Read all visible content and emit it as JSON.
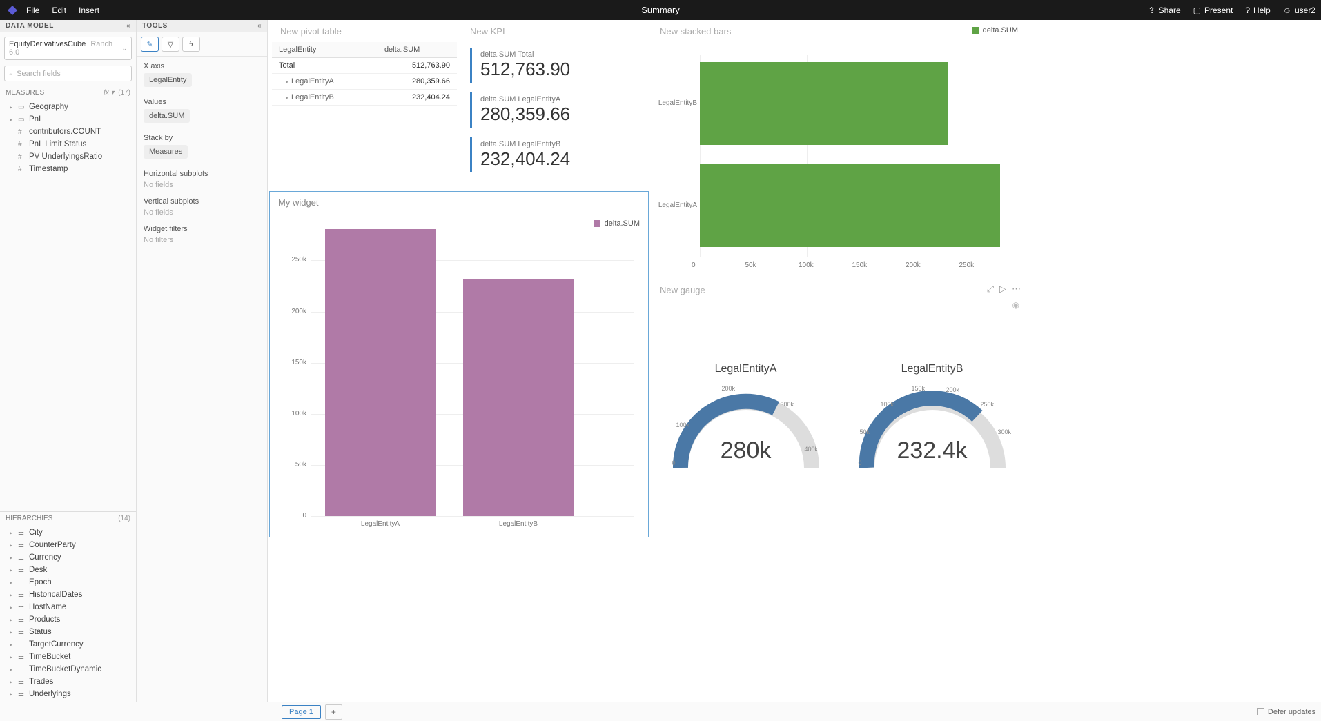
{
  "topbar": {
    "menus": [
      "File",
      "Edit",
      "Insert"
    ],
    "title": "Summary",
    "right": [
      {
        "icon": "share",
        "label": "Share"
      },
      {
        "icon": "present",
        "label": "Present"
      },
      {
        "icon": "help",
        "label": "Help"
      },
      {
        "icon": "user",
        "label": "user2"
      }
    ]
  },
  "data_model": {
    "header": "DATA MODEL",
    "cube": "EquityDerivativesCube",
    "cube_hint": "Ranch 6.0",
    "search_placeholder": "Search fields",
    "measures_header": "MEASURES",
    "measures_count": "(17)",
    "measures_folders": [
      {
        "name": "Geography"
      },
      {
        "name": "PnL"
      }
    ],
    "measures_items": [
      "contributors.COUNT",
      "PnL Limit Status",
      "PV UnderlyingsRatio",
      "Timestamp"
    ],
    "hierarchies_header": "HIERARCHIES",
    "hierarchies_count": "(14)",
    "hierarchies": [
      "City",
      "CounterParty",
      "Currency",
      "Desk",
      "Epoch",
      "HistoricalDates",
      "HostName",
      "Products",
      "Status",
      "TargetCurrency",
      "TimeBucket",
      "TimeBucketDynamic",
      "Trades",
      "Underlyings"
    ]
  },
  "tools": {
    "header": "TOOLS",
    "xaxis_label": "X axis",
    "xaxis_chip": "LegalEntity",
    "values_label": "Values",
    "values_chip": "delta.SUM",
    "stack_label": "Stack by",
    "stack_chip": "Measures",
    "hsub_label": "Horizontal subplots",
    "vsub_label": "Vertical subplots",
    "filters_label": "Widget filters",
    "no_fields": "No fields",
    "no_filters": "No filters"
  },
  "widgets": {
    "pivot": {
      "title": "New pivot table",
      "col1": "LegalEntity",
      "col2": "delta.SUM",
      "rows": [
        {
          "label": "Total",
          "value": "512,763.90",
          "sub": false
        },
        {
          "label": "LegalEntityA",
          "value": "280,359.66",
          "sub": true
        },
        {
          "label": "LegalEntityB",
          "value": "232,404.24",
          "sub": true
        }
      ]
    },
    "kpi": {
      "title": "New KPI",
      "items": [
        {
          "label": "delta.SUM Total",
          "value": "512,763.90"
        },
        {
          "label": "delta.SUM LegalEntityA",
          "value": "280,359.66"
        },
        {
          "label": "delta.SUM LegalEntityB",
          "value": "232,404.24"
        }
      ]
    },
    "stacked": {
      "title": "New stacked bars",
      "legend": "delta.SUM"
    },
    "mywidget": {
      "title": "My widget",
      "legend": "delta.SUM"
    },
    "gauge": {
      "title": "New gauge",
      "g1_title": "LegalEntityA",
      "g1_value": "280k",
      "g2_title": "LegalEntityB",
      "g2_value": "232.4k"
    }
  },
  "bottom": {
    "page": "Page 1",
    "defer": "Defer updates"
  },
  "chart_data": [
    {
      "type": "bar",
      "widget": "My widget",
      "orientation": "vertical",
      "categories": [
        "LegalEntityA",
        "LegalEntityB"
      ],
      "series": [
        {
          "name": "delta.SUM",
          "values": [
            280359.66,
            232404.24
          ],
          "color": "#b07aa7"
        }
      ],
      "ylim": [
        0,
        280000
      ],
      "yticks": [
        0,
        50000,
        100000,
        150000,
        200000,
        250000
      ],
      "ytick_labels": [
        "0",
        "50k",
        "100k",
        "150k",
        "200k",
        "250k"
      ]
    },
    {
      "type": "bar",
      "widget": "New stacked bars",
      "orientation": "horizontal",
      "categories": [
        "LegalEntityB",
        "LegalEntityA"
      ],
      "series": [
        {
          "name": "delta.SUM",
          "values": [
            232404.24,
            280359.66
          ],
          "color": "#5fa345"
        }
      ],
      "xlim": [
        0,
        300000
      ],
      "xticks": [
        0,
        50000,
        100000,
        150000,
        200000,
        250000
      ],
      "xtick_labels": [
        "0",
        "50k",
        "100k",
        "150k",
        "200k",
        "250k"
      ]
    },
    {
      "type": "gauge",
      "widget": "New gauge",
      "gauges": [
        {
          "title": "LegalEntityA",
          "value": 280000,
          "display": "280k",
          "min": 0,
          "max": 500000,
          "ticks": [
            0,
            100000,
            200000,
            300000,
            400000
          ],
          "tick_labels": [
            "0",
            "100k",
            "200k",
            "300k",
            "400k"
          ]
        },
        {
          "title": "LegalEntityB",
          "value": 232400,
          "display": "232.4k",
          "min": 0,
          "max": 400000,
          "ticks": [
            0,
            50000,
            100000,
            150000,
            200000,
            250000,
            300000
          ],
          "tick_labels": [
            "0",
            "50k",
            "100k",
            "150k",
            "200k",
            "250k",
            "300k"
          ]
        }
      ]
    }
  ]
}
